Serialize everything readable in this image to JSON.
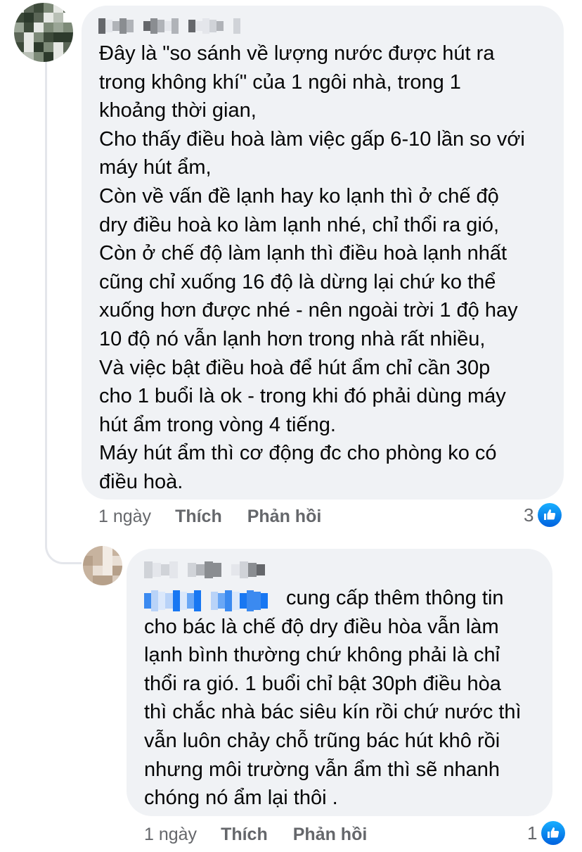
{
  "comments": [
    {
      "text": "Đây là \"so sánh về lượng nước được hút ra\ntrong không khí\" của 1 ngôi nhà, trong 1\nkhoảng thời gian,\nCho thấy điều hoà làm việc gấp 6-10 lần so với\nmáy hút ẩm,\nCòn về vấn đề lạnh hay ko lạnh thì ở chế độ\ndry điều hoà ko làm lạnh nhé, chỉ thổi ra gió,\nCòn ở chế độ làm lạnh thì điều hoà lạnh nhất\ncũng chỉ xuống 16 độ là dừng lại chứ ko thể\nxuống hơn được nhé - nên ngoài trời 1 độ hay\n10 độ nó vẫn lạnh hơn trong nhà rất nhiều,\nVà việc bật điều hoà để hút ẩm chỉ cần 30p\ncho 1 buổi là ok - trong khi đó phải dùng máy\nhút ẩm trong vòng 4 tiếng.\nMáy hút ẩm thì cơ động đc cho phòng ko có\nđiều hoà.",
      "time": "1 ngày",
      "like_label": "Thích",
      "reply_label": "Phản hồi",
      "reaction_count": "3",
      "reaction_icon": "like-icon"
    },
    {
      "text": "cung cấp thêm thông tin\ncho bác là chế độ dry điều hòa vẫn làm\nlạnh bình thường chứ không phải là chỉ\nthổi ra gió. 1 buổi chỉ bật 30ph điều hòa\nthì chắc nhà bác siêu kín rồi chứ nước thì\nvẫn luôn chảy chỗ trũng bác hút khô rồi\nnhưng môi trường vẫn ẩm thì sẽ nhanh\nchóng nó ẩm lại thôi .",
      "time": "1 ngày",
      "like_label": "Thích",
      "reply_label": "Phản hồi",
      "reaction_count": "1",
      "reaction_icon": "like-icon"
    }
  ],
  "colors": {
    "bubble": "#f0f2f5",
    "meta_text": "#65676b",
    "like_blue": "#1877f2",
    "thread_line": "#e4e6eb"
  }
}
